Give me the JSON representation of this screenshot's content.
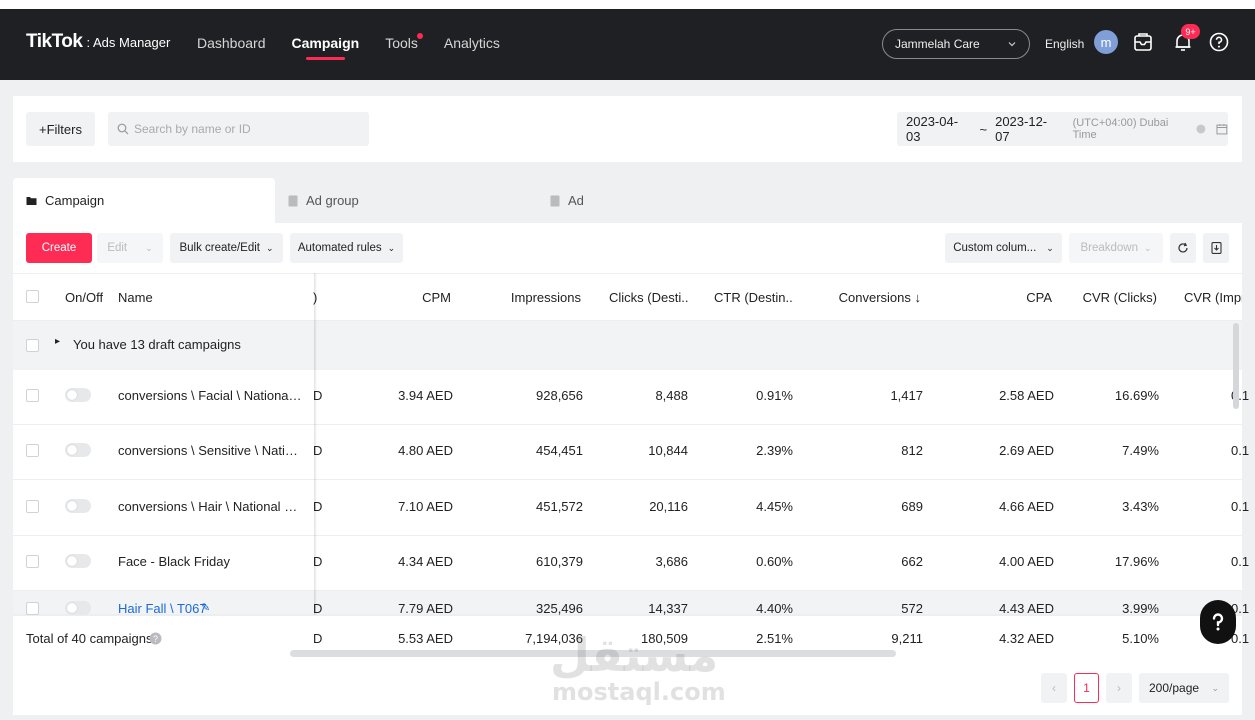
{
  "app": {
    "logo_main": "TikTok",
    "logo_sub": ": Ads Manager",
    "nav": [
      "Dashboard",
      "Campaign",
      "Tools",
      "Analytics"
    ],
    "active_nav": "Campaign",
    "account": "Jammelah Care",
    "language": "English",
    "avatar_letter": "m",
    "notification_badge": "9+"
  },
  "filters": {
    "filters_label": "+Filters",
    "search_placeholder": "Search by name or ID",
    "date_start": "2023-04-03",
    "date_sep": "~",
    "date_end": "2023-12-07",
    "timezone": "(UTC+04:00) Dubai Time"
  },
  "tabs": [
    "Campaign",
    "Ad group",
    "Ad"
  ],
  "toolbar": {
    "create": "Create",
    "edit": "Edit",
    "bulk": "Bulk create/Edit",
    "automated": "Automated rules",
    "custom_columns": "Custom colum...",
    "breakdown": "Breakdown"
  },
  "columns": {
    "onoff": "On/Off",
    "name": "Name",
    "clipped": ")",
    "cpm": "CPM",
    "impressions": "Impressions",
    "clicks": "Clicks (Desti...",
    "ctr": "CTR (Destin...",
    "conversions": "Conversions ↓",
    "cpa": "CPA",
    "cvr_clicks": "CVR (Clicks)",
    "cvr_impr": "CVR (Impre"
  },
  "draft": "You have 13 draft campaigns",
  "rows": [
    {
      "name": "conversions \\ Facial \\ National day",
      "c": "D",
      "cpm": "3.94 AED",
      "impr": "928,656",
      "clicks": "8,488",
      "ctr": "0.91%",
      "conv": "1,417",
      "cpa": "2.58 AED",
      "cvr": "16.69%",
      "cvr2": "0.1"
    },
    {
      "name": "conversions \\ Sensitive \\ Nation...",
      "c": "D",
      "cpm": "4.80 AED",
      "impr": "454,451",
      "clicks": "10,844",
      "ctr": "2.39%",
      "conv": "812",
      "cpa": "2.69 AED",
      "cvr": "7.49%",
      "cvr2": "0.1"
    },
    {
      "name": "conversions \\ Hair \\ National Day",
      "c": "D",
      "cpm": "7.10 AED",
      "impr": "451,572",
      "clicks": "20,116",
      "ctr": "4.45%",
      "conv": "689",
      "cpa": "4.66 AED",
      "cvr": "3.43%",
      "cvr2": "0.1"
    },
    {
      "name": "Face - Black Friday",
      "c": "D",
      "cpm": "4.34 AED",
      "impr": "610,379",
      "clicks": "3,686",
      "ctr": "0.60%",
      "conv": "662",
      "cpa": "4.00 AED",
      "cvr": "17.96%",
      "cvr2": "0.1"
    },
    {
      "name": "Hair Fall \\ T067",
      "c": "D",
      "cpm": "7.79 AED",
      "impr": "325,496",
      "clicks": "14,337",
      "ctr": "4.40%",
      "conv": "572",
      "cpa": "4.43 AED",
      "cvr": "3.99%",
      "cvr2": "0.1"
    }
  ],
  "total": {
    "label": "Total of 40 campaigns",
    "c": "D",
    "cpm": "5.53 AED",
    "impr": "7,194,036",
    "clicks": "180,509",
    "ctr": "2.51%",
    "conv": "9,211",
    "cpa": "4.32 AED",
    "cvr": "5.10%",
    "cvr2": "0.1"
  },
  "pagination": {
    "current": "1",
    "page_size": "200/page"
  },
  "watermark": {
    "arabic": "مستقل",
    "latin": "mostaql.com"
  },
  "colors": {
    "accent": "#fe2c55",
    "topbar": "#1f2023",
    "link": "#1a6bd8"
  }
}
